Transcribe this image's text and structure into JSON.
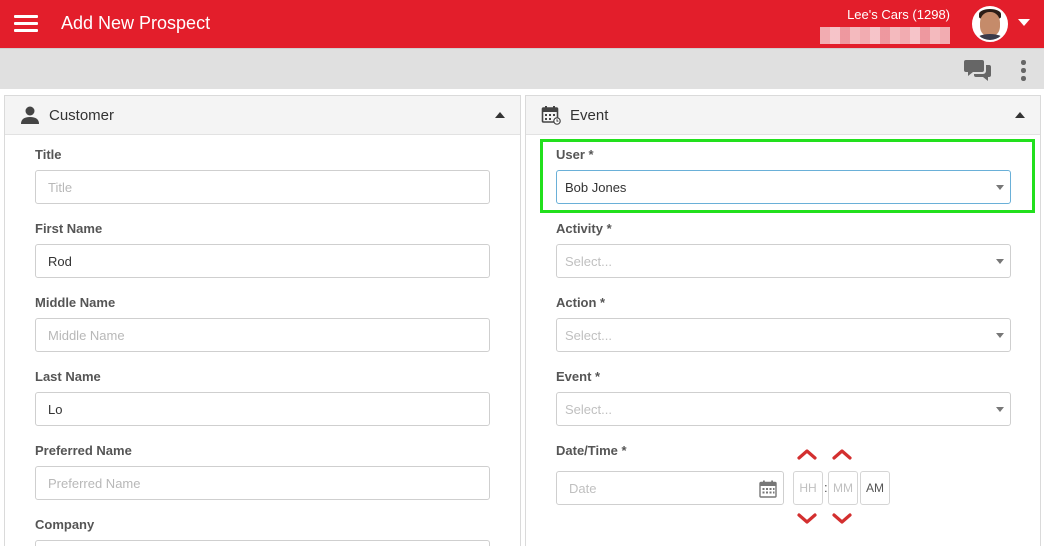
{
  "header": {
    "title": "Add New Prospect",
    "dealer": "Lee's Cars (1298)"
  },
  "colors": {
    "brand": "#e31e2b",
    "highlight": "#22e01d",
    "chevron": "#d32f2f"
  },
  "customer_panel": {
    "title": "Customer",
    "fields": {
      "title": {
        "label": "Title",
        "value": "",
        "placeholder": "Title"
      },
      "first_name": {
        "label": "First Name",
        "value": "Rod",
        "placeholder": "First Name"
      },
      "middle_name": {
        "label": "Middle Name",
        "value": "",
        "placeholder": "Middle Name"
      },
      "last_name": {
        "label": "Last Name",
        "value": "Lo",
        "placeholder": "Last Name"
      },
      "preferred_name": {
        "label": "Preferred Name",
        "value": "",
        "placeholder": "Preferred Name"
      },
      "company": {
        "label": "Company"
      }
    }
  },
  "event_panel": {
    "title": "Event",
    "user": {
      "label": "User *",
      "value": "Bob Jones"
    },
    "activity": {
      "label": "Activity *",
      "placeholder": "Select..."
    },
    "action": {
      "label": "Action *",
      "placeholder": "Select..."
    },
    "event": {
      "label": "Event *",
      "placeholder": "Select..."
    },
    "datetime": {
      "label": "Date/Time *",
      "date_placeholder": "Date",
      "hour_placeholder": "HH",
      "minute_placeholder": "MM",
      "separator": ":",
      "ampm": "AM"
    }
  },
  "icons": {
    "menu": "hamburger-icon",
    "chat": "chat-icon",
    "more": "kebab-icon",
    "customer": "person-icon",
    "event": "calendar-icon",
    "date": "calendar-icon"
  }
}
